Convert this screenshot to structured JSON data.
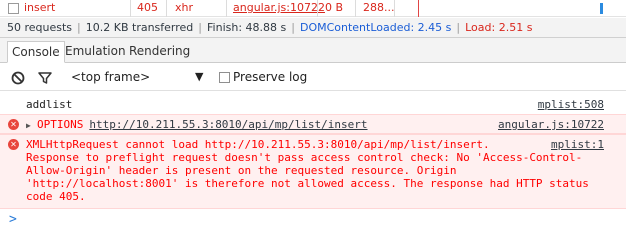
{
  "network_row": {
    "name": "insert",
    "status": "405",
    "type": "xhr",
    "initiator": "angular.js:10722",
    "size": "0 B",
    "time": "288..."
  },
  "summary": {
    "requests": "50 requests",
    "transferred": "10.2 KB transferred",
    "finish": "Finish: 48.88 s",
    "dom_content_loaded": "DOMContentLoaded: 2.45 s",
    "load": "Load: 2.51 s",
    "separator": "|"
  },
  "tabs": [
    "Console",
    "Emulation",
    "Rendering"
  ],
  "toolbar": {
    "clear_icon": "clear-console-icon",
    "filter_icon": "filter-icon",
    "frame_selector": "<top frame>",
    "dropdown_glyph": "▼",
    "preserve_log_label": "Preserve log",
    "preserve_log_checked": false
  },
  "console": {
    "log": {
      "text": "addlist",
      "source": "mplist:508"
    },
    "error1": {
      "method": "OPTIONS",
      "url": "http://10.211.55.3:8010/api/mp/list/insert",
      "source": "angular.js:10722"
    },
    "error2": {
      "text": "XMLHttpRequest cannot load http://10.211.55.3:8010/api/mp/list/insert.\nResponse to preflight request doesn't pass access control check: No 'Access-Control-\nAllow-Origin' header is present on the requested resource. Origin\n'http://localhost:8001' is therefore not allowed access. The response had HTTP status\ncode 405.",
      "source": "mplist:1"
    },
    "prompt": ">"
  },
  "colors": {
    "error_text": "#ff0000",
    "error_bg": "#fff0f0",
    "dcl_blue": "#1a5dd6",
    "load_red": "#d9261c"
  }
}
